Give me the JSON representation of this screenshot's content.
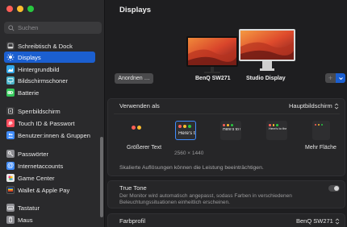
{
  "colors": {
    "accent": "#1b5fd0",
    "close": "#ff5f57",
    "minimize": "#febc2e",
    "zoom": "#28c840"
  },
  "search": {
    "placeholder": "Suchen"
  },
  "sidebar": {
    "items": [
      {
        "label": "Schreibtisch & Dock",
        "icon": "dock-icon",
        "color": "#3a3a3c"
      },
      {
        "label": "Displays",
        "icon": "sun-icon",
        "color": "#1b5fd0",
        "active": true
      },
      {
        "label": "Hintergrundbild",
        "icon": "wallpaper-icon",
        "color": "#34a7e8"
      },
      {
        "label": "Bildschirmschoner",
        "icon": "screensaver-icon",
        "color": "#4ab3c9"
      },
      {
        "label": "Batterie",
        "icon": "battery-icon",
        "color": "#34c759"
      },
      {
        "label": "Sperrbildschirm",
        "icon": "lock-screen-icon",
        "color": "#3a3a3c"
      },
      {
        "label": "Touch ID & Passwort",
        "icon": "fingerprint-icon",
        "color": "#ff4d5e"
      },
      {
        "label": "Benutzer:innen & Gruppen",
        "icon": "users-icon",
        "color": "#3f8cff"
      },
      {
        "label": "Passwörter",
        "icon": "key-icon",
        "color": "#8e8e93"
      },
      {
        "label": "Internetaccounts",
        "icon": "at-icon",
        "color": "#3f8cff"
      },
      {
        "label": "Game Center",
        "icon": "game-center-icon",
        "color": "#e8e8e8"
      },
      {
        "label": "Wallet & Apple Pay",
        "icon": "wallet-icon",
        "color": "#2c2c2e"
      },
      {
        "label": "Tastatur",
        "icon": "keyboard-icon",
        "color": "#8e8e93"
      },
      {
        "label": "Maus",
        "icon": "mouse-icon",
        "color": "#8e8e93"
      }
    ]
  },
  "main": {
    "title": "Displays",
    "arrange_button": "Anordnen …",
    "monitors": [
      {
        "name": "BenQ SW271"
      },
      {
        "name": "Studio Display"
      }
    ],
    "use_as": {
      "label": "Verwenden als",
      "value": "Hauptbildschirm"
    },
    "resolution": {
      "options": [
        {
          "sample": "",
          "label": "Größerer Text"
        },
        {
          "sample": "Here's troubles",
          "label": "2560 × 1440",
          "selected": true
        },
        {
          "sample": "Here's to t troublema",
          "label": ""
        },
        {
          "sample": "Here's to the c troublemakers",
          "label": ""
        },
        {
          "sample": "",
          "label": "Mehr Fläche"
        }
      ],
      "note": "Skalierte Auflösungen können die Leistung beeinträchtigen."
    },
    "true_tone": {
      "label": "True Tone",
      "description_line1": "Der Monitor wird automatisch angepasst, sodass Farben in verschiedenen",
      "description_line2": "Beleuchtungssituationen einheitlich erscheinen."
    },
    "color_profile": {
      "label": "Farbprofil",
      "value": "BenQ SW271"
    }
  }
}
